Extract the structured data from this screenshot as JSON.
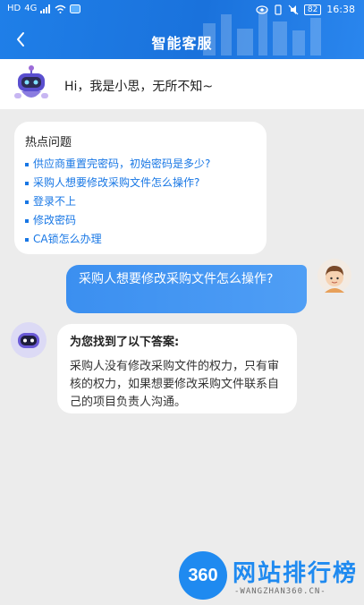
{
  "status_bar": {
    "left_icons": [
      "HD",
      "4G",
      "signal-icon",
      "wifi-icon",
      "notification-icon"
    ],
    "right_icons": [
      "eye-icon",
      "vibrate-icon",
      "mute-icon"
    ],
    "battery": "82",
    "time": "16:38"
  },
  "header": {
    "title": "智能客服"
  },
  "greeting": {
    "text": "Hi，我是小思，无所不知~"
  },
  "hot_questions": {
    "title": "热点问题",
    "items": [
      "供应商重置完密码，初始密码是多少?",
      "采购人想要修改采购文件怎么操作?",
      "登录不上",
      "修改密码",
      "CA锁怎么办理"
    ]
  },
  "user_message": {
    "text": "采购人想要修改采购文件怎么操作?"
  },
  "bot_answer": {
    "title": "为您找到了以下答案:",
    "body": "采购人没有修改采购文件的权力，只有审核的权力，如果想要修改采购文件联系自己的项目负责人沟通。"
  },
  "watermark": {
    "logo": "360",
    "text": "网站排行榜",
    "sub": "-WANGZHAN360.CN-"
  },
  "colors": {
    "primary": "#1f7fe8",
    "link": "#1877e5",
    "user_bubble": "#3b8ff0",
    "background": "#ececec"
  }
}
